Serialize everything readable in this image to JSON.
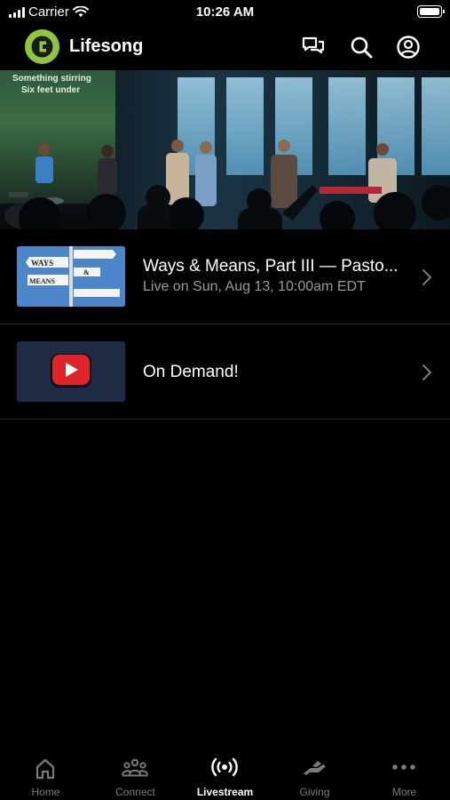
{
  "status_bar": {
    "carrier": "Carrier",
    "time": "10:26 AM"
  },
  "header": {
    "app_name": "Lifesong",
    "icons": [
      "chat-icon",
      "search-icon",
      "profile-icon"
    ]
  },
  "hero": {
    "caption_line1": "Something stirring",
    "caption_line2": "Six feet under"
  },
  "items": [
    {
      "title": "Ways & Means, Part III — Pasto...",
      "subtitle": "Live on Sun, Aug 13, 10:00am EDT",
      "thumb_sign1": "WAYS",
      "thumb_sign2": "&",
      "thumb_sign3": "MEANS"
    },
    {
      "title": "On Demand!"
    }
  ],
  "tabs": [
    {
      "label": "Home",
      "icon": "home-icon"
    },
    {
      "label": "Connect",
      "icon": "people-icon"
    },
    {
      "label": "Livestream",
      "icon": "broadcast-icon",
      "active": true
    },
    {
      "label": "Giving",
      "icon": "giving-hand-icon"
    },
    {
      "label": "More",
      "icon": "more-dots-icon"
    }
  ],
  "colors": {
    "background": "#000000",
    "brand": "#8dc63f",
    "muted_text": "#9a9a9a",
    "tab_inactive": "#7a7a7a"
  }
}
